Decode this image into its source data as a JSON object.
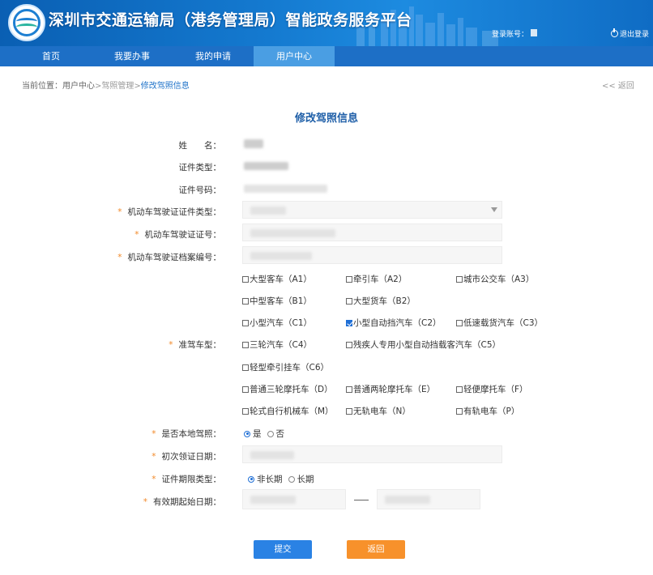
{
  "header": {
    "site_title": "深圳市交通运输局（港务管理局）智能政务服务平台",
    "login_label": "登录账号：",
    "logout_label": "退出登录"
  },
  "nav": {
    "items": [
      {
        "label": "首页"
      },
      {
        "label": "我要办事"
      },
      {
        "label": "我的申请"
      },
      {
        "label": "用户中心"
      }
    ],
    "active": "用户中心"
  },
  "breadcrumb": {
    "prefix": "当前位置：",
    "level1": "用户中心",
    "sep1": ">",
    "level2": "驾照管理",
    "sep2": ">",
    "current": "修改驾照信息",
    "back": "<< 返回"
  },
  "form": {
    "title": "修改驾照信息",
    "required_mark": "*",
    "labels": {
      "name": "姓　　名：",
      "cert_type": "证件类型：",
      "cert_no": "证件号码：",
      "license_cert_type": "机动车驾驶证证件类型：",
      "license_no": "机动车驾驶证证号：",
      "license_file_no": "机动车驾驶证档案编号：",
      "vehicle_class": "准驾车型：",
      "is_local": "是否本地驾照：",
      "first_issue_date": "初次领证日期：",
      "validity_type": "证件期限类型：",
      "valid_from": "有效期起始日期："
    },
    "vehicle_classes": [
      {
        "label": "大型客车（A1）",
        "checked": false
      },
      {
        "label": "牵引车（A2）",
        "checked": false
      },
      {
        "label": "城市公交车（A3）",
        "checked": false
      },
      {
        "label": "中型客车（B1）",
        "checked": false
      },
      {
        "label": "大型货车（B2）",
        "checked": false
      },
      {
        "label": "小型汽车（C1）",
        "checked": false
      },
      {
        "label": "小型自动挡汽车（C2）",
        "checked": true
      },
      {
        "label": "低速载货汽车（C3）",
        "checked": false
      },
      {
        "label": "三轮汽车（C4）",
        "checked": false
      },
      {
        "label": "残疾人专用小型自动挡载客汽车（C5）",
        "checked": false
      },
      {
        "label": "轻型牵引挂车（C6）",
        "checked": false
      },
      {
        "label": "普通三轮摩托车（D）",
        "checked": false
      },
      {
        "label": "普通两轮摩托车（E）",
        "checked": false
      },
      {
        "label": "轻便摩托车（F）",
        "checked": false
      },
      {
        "label": "轮式自行机械车（M）",
        "checked": false
      },
      {
        "label": "无轨电车（N）",
        "checked": false
      },
      {
        "label": "有轨电车（P）",
        "checked": false
      }
    ],
    "is_local_options": [
      {
        "label": "是",
        "selected": true
      },
      {
        "label": "否",
        "selected": false
      }
    ],
    "validity_type_options": [
      {
        "label": "非长期",
        "selected": true
      },
      {
        "label": "长期",
        "selected": false
      }
    ],
    "submit_label": "提交",
    "return_label": "返回"
  },
  "colors": {
    "nav_bar": "#1d6fc6",
    "nav_active": "#4a9ee3",
    "title": "#1f5fa8",
    "required": "#f28a2a",
    "submit": "#2a82e4",
    "return": "#f7912b"
  },
  "icons": [
    "logo-emblem",
    "power-icon",
    "dropdown-arrow-icon",
    "checkbox",
    "radio"
  ]
}
